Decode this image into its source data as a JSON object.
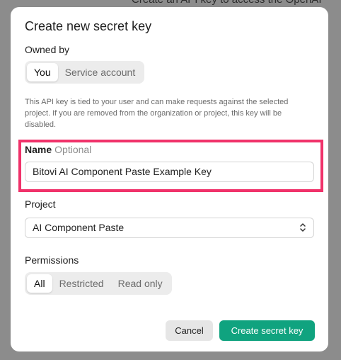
{
  "background": {
    "partial_text": "Create an API key to access the OpenAI"
  },
  "modal": {
    "title": "Create new secret key",
    "owned_by": {
      "label": "Owned by",
      "options": [
        "You",
        "Service account"
      ],
      "selected": "You"
    },
    "description": "This API key is tied to your user and can make requests against the selected project. If you are removed from the organization or project, this key will be disabled.",
    "name": {
      "label": "Name",
      "optional": "Optional",
      "value": "Bitovi AI Component Paste Example Key"
    },
    "project": {
      "label": "Project",
      "value": "AI Component Paste"
    },
    "permissions": {
      "label": "Permissions",
      "options": [
        "All",
        "Restricted",
        "Read only"
      ],
      "selected": "All"
    },
    "buttons": {
      "cancel": "Cancel",
      "create": "Create secret key"
    }
  },
  "colors": {
    "primary": "#10a37f",
    "highlight": "#f0326a"
  },
  "icons": {
    "project_select": "chevron-up-down-icon"
  }
}
